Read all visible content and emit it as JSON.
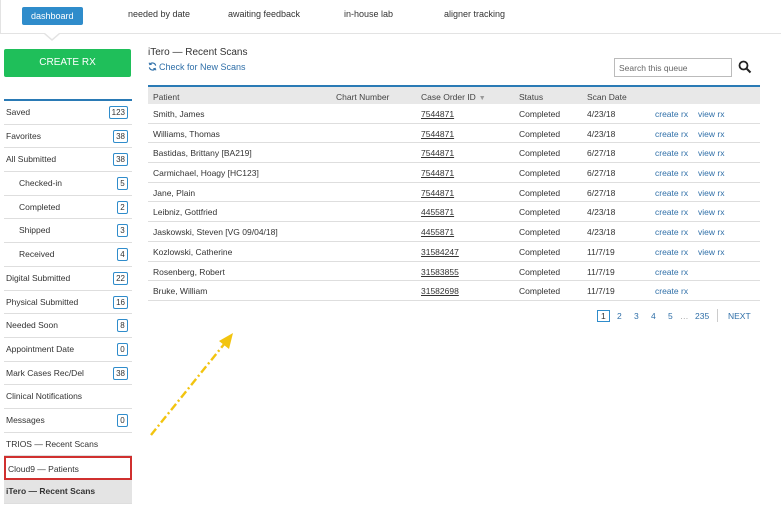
{
  "nav": {
    "tabs": [
      {
        "label": "dashboard"
      },
      {
        "label": "needed by date"
      },
      {
        "label": "awaiting feedback"
      },
      {
        "label": "in-house lab"
      },
      {
        "label": "aligner tracking"
      }
    ]
  },
  "sidebar": {
    "create_label": "CREATE RX",
    "items": [
      {
        "label": "Saved",
        "badge": "123"
      },
      {
        "label": "Favorites",
        "badge": "38"
      },
      {
        "label": "All Submitted",
        "badge": "38"
      },
      {
        "label": "Checked-in",
        "badge": "5"
      },
      {
        "label": "Completed",
        "badge": "2"
      },
      {
        "label": "Shipped",
        "badge": "3"
      },
      {
        "label": "Received",
        "badge": "4"
      },
      {
        "label": "Digital Submitted",
        "badge": "22"
      },
      {
        "label": "Physical Submitted",
        "badge": "16"
      },
      {
        "label": "Needed Soon",
        "badge": "8"
      },
      {
        "label": "Appointment Date",
        "badge": "0"
      },
      {
        "label": "Mark Cases Rec/Del",
        "badge": "38"
      },
      {
        "label": "Clinical Notifications"
      },
      {
        "label": "Messages",
        "badge": "0"
      },
      {
        "label": "TRIOS — Recent Scans"
      },
      {
        "label": "Cloud9 — Patients"
      },
      {
        "label": "iTero — Recent Scans"
      }
    ]
  },
  "main": {
    "title": "iTero — Recent Scans",
    "check_link": "Check for New Scans",
    "search_placeholder": "Search this queue"
  },
  "table": {
    "columns": [
      "Patient",
      "Chart Number",
      "Case Order ID",
      "Status",
      "Scan Date"
    ],
    "rows": [
      {
        "patient": "Smith, James",
        "chart": "",
        "case_id": "7544871",
        "status": "Completed",
        "date": "4/23/18",
        "create": "create rx",
        "view": "view rx"
      },
      {
        "patient": "Williams, Thomas",
        "chart": "",
        "case_id": "7544871",
        "status": "Completed",
        "date": "4/23/18",
        "create": "create rx",
        "view": "view rx"
      },
      {
        "patient": "Bastidas, Brittany [BA219]",
        "chart": "",
        "case_id": "7544871",
        "status": "Completed",
        "date": "6/27/18",
        "create": "create rx",
        "view": "view rx"
      },
      {
        "patient": "Carmichael, Hoagy [HC123]",
        "chart": "",
        "case_id": "7544871",
        "status": "Completed",
        "date": "6/27/18",
        "create": "create rx",
        "view": "view rx"
      },
      {
        "patient": "Jane, Plain",
        "chart": "",
        "case_id": "7544871",
        "status": "Completed",
        "date": "6/27/18",
        "create": "create rx",
        "view": "view rx"
      },
      {
        "patient": "Leibniz, Gottfried",
        "chart": "",
        "case_id": "4455871",
        "status": "Completed",
        "date": "4/23/18",
        "create": "create rx",
        "view": "view rx"
      },
      {
        "patient": "Jaskowski, Steven [VG 09/04/18]",
        "chart": "",
        "case_id": "4455871",
        "status": "Completed",
        "date": "4/23/18",
        "create": "create rx",
        "view": "view rx"
      },
      {
        "patient": "Kozlowski, Catherine",
        "chart": "",
        "case_id": "31584247",
        "status": "Completed",
        "date": "11/7/19",
        "create": "create rx",
        "view": "view rx"
      },
      {
        "patient": "Rosenberg, Robert",
        "chart": "",
        "case_id": "31583855",
        "status": "Completed",
        "date": "11/7/19",
        "create": "create rx",
        "view": ""
      },
      {
        "patient": "Bruke, William",
        "chart": "",
        "case_id": "31582698",
        "status": "Completed",
        "date": "11/7/19",
        "create": "create rx",
        "view": ""
      }
    ]
  },
  "pagination": {
    "pages": [
      "1",
      "2",
      "3",
      "4",
      "5"
    ],
    "ellipsis": "…",
    "last": "235",
    "next": "NEXT",
    "current": "1"
  },
  "colors": {
    "accent": "#2f8ccb",
    "create_button": "#1fbf5a",
    "highlight": "#d0302f",
    "arrow": "#f2c40f"
  }
}
